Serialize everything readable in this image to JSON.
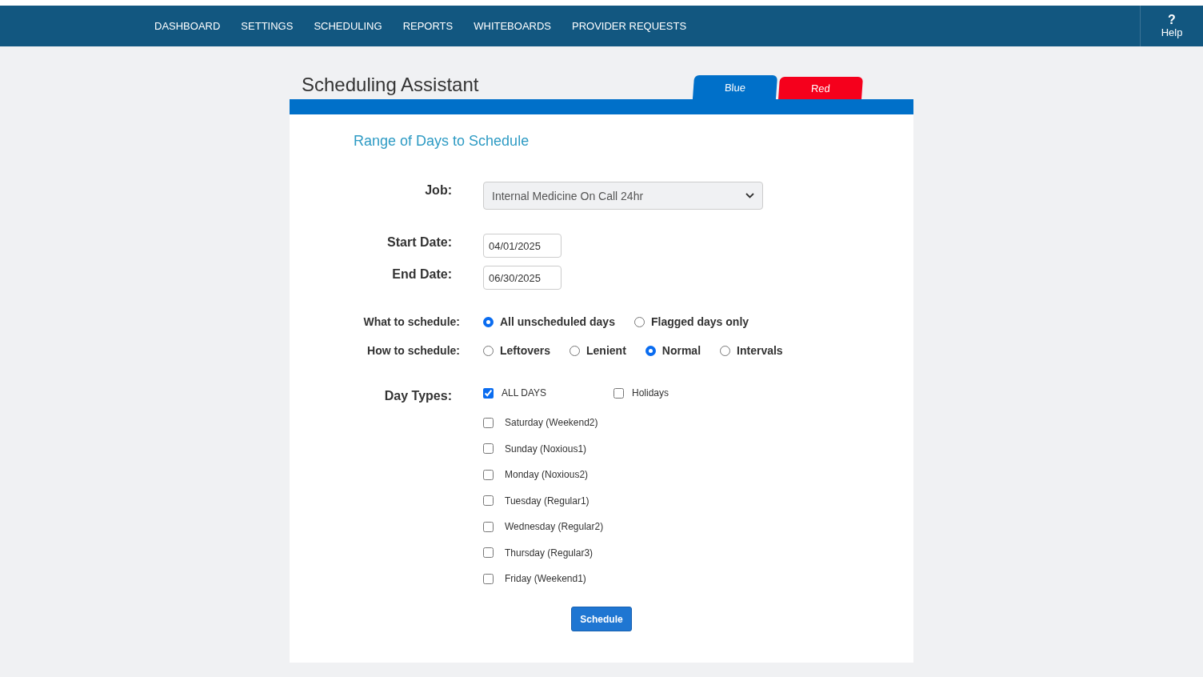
{
  "nav": {
    "items": [
      {
        "label": "DASHBOARD"
      },
      {
        "label": "SETTINGS"
      },
      {
        "label": "SCHEDULING"
      },
      {
        "label": "REPORTS"
      },
      {
        "label": "WHITEBOARDS"
      },
      {
        "label": "PROVIDER REQUESTS"
      }
    ],
    "help": {
      "glyph": "?",
      "label": "Help"
    }
  },
  "title": "Scheduling Assistant",
  "tabs": [
    {
      "label": "Blue",
      "color": "#0070c9",
      "selected": true
    },
    {
      "label": "Red",
      "color": "#f5001c",
      "selected": false
    }
  ],
  "section_title": "Range of Days to Schedule",
  "job": {
    "label": "Job:",
    "value": "Internal Medicine On Call 24hr"
  },
  "start_date": {
    "label": "Start Date:",
    "value": "04/01/2025"
  },
  "end_date": {
    "label": "End Date:",
    "value": "06/30/2025"
  },
  "what_to_schedule": {
    "label": "What to schedule:",
    "options": [
      {
        "label": "All unscheduled days",
        "selected": true
      },
      {
        "label": "Flagged days only",
        "selected": false
      }
    ]
  },
  "how_to_schedule": {
    "label": "How to schedule:",
    "options": [
      {
        "label": "Leftovers",
        "selected": false
      },
      {
        "label": "Lenient",
        "selected": false
      },
      {
        "label": "Normal",
        "selected": true
      },
      {
        "label": "Intervals",
        "selected": false
      }
    ]
  },
  "day_types": {
    "label": "Day Types:",
    "top": [
      {
        "label": "ALL DAYS",
        "checked": true
      },
      {
        "label": "Holidays",
        "checked": false
      }
    ],
    "days": [
      {
        "label": "Saturday (Weekend2)",
        "checked": false
      },
      {
        "label": "Sunday (Noxious1)",
        "checked": false
      },
      {
        "label": "Monday (Noxious2)",
        "checked": false
      },
      {
        "label": "Tuesday (Regular1)",
        "checked": false
      },
      {
        "label": "Wednesday (Regular2)",
        "checked": false
      },
      {
        "label": "Thursday (Regular3)",
        "checked": false
      },
      {
        "label": "Friday (Weekend1)",
        "checked": false
      }
    ]
  },
  "schedule_button": "Schedule"
}
